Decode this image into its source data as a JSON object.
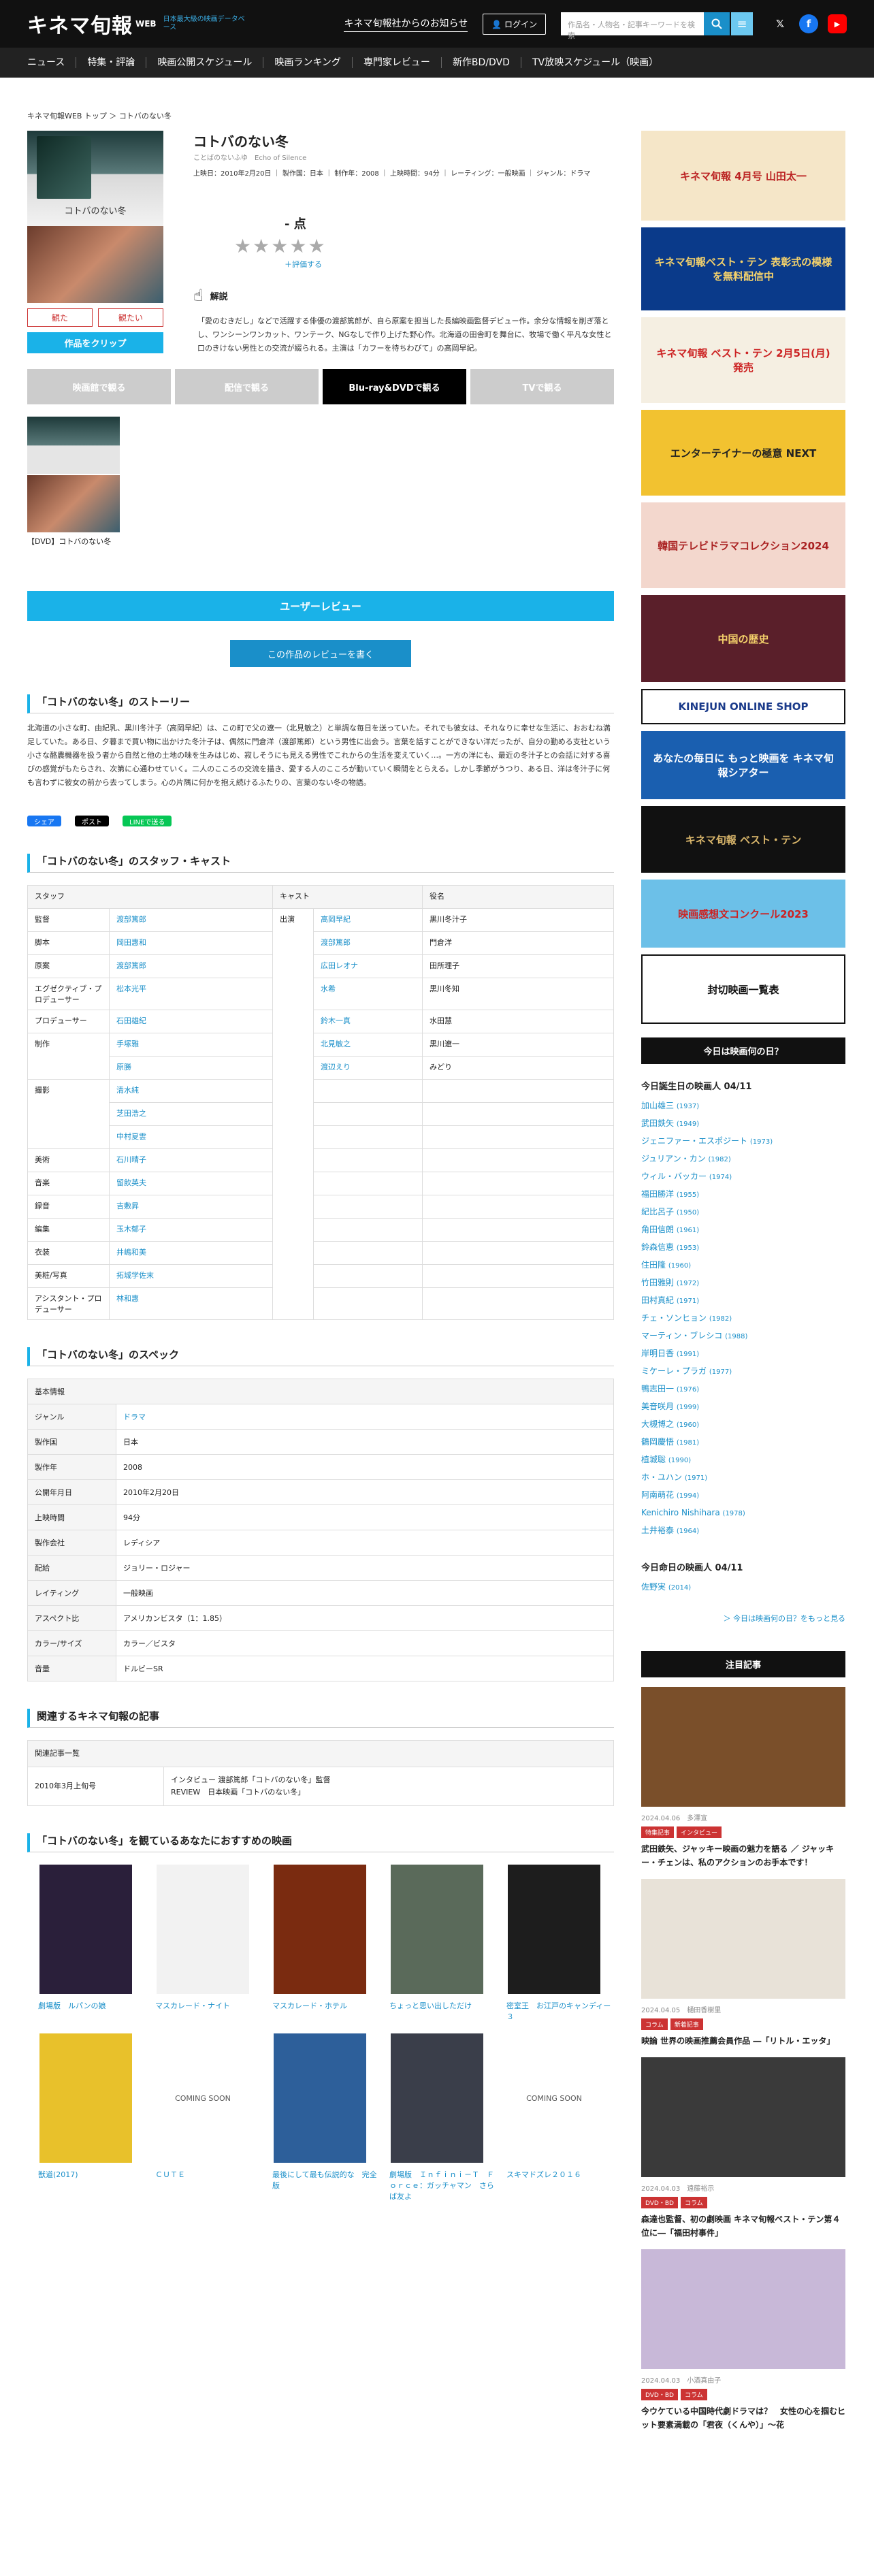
{
  "header": {
    "logo": "キネマ旬報",
    "logo_web": "WEB",
    "logo_sub": "日本最大級の映画データベース",
    "news_link": "キネマ旬報社からのお知らせ",
    "login": "ログイン",
    "search_placeholder": "作品名・人物名・記事キーワードを検索"
  },
  "nav": [
    "ニュース",
    "特集・評論",
    "映画公開スケジュール",
    "映画ランキング",
    "専門家レビュー",
    "新作BD/DVD",
    "TV放映スケジュール（映画）"
  ],
  "breadcrumb": "キネマ旬報WEB トップ ＞ コトバのない冬",
  "film": {
    "poster_text": "コトバのない冬",
    "title": "コトバのない冬",
    "kana": "ことばのないふゆ　Echo of Silence",
    "meta": "上映日：2010年2月20日 ｜ 製作国：日本 ｜ 制作年：2008 ｜ 上映時間：94分 ｜ レーティング：一般映画 ｜ ジャンル：ドラマ",
    "score": "- 点",
    "rate_link": "＋評価する",
    "seen": "観た",
    "want": "観たい",
    "clip": "作品をクリップ",
    "kaisetsu_label": "解説",
    "kaisetsu": "「愛のむきだし」などで活躍する俳優の渡部篤郎が、自ら原案を担当した長編映画監督デビュー作。余分な情報を削ぎ落とし、ワンシーンワンカット、ワンテーク、NGなしで作り上げた野心作。北海道の田舎町を舞台に、牧場で働く平凡な女性と口のきけない男性との交流が綴られる。主演は「カフーを待ちわびて」の高岡早紀。"
  },
  "tabs": [
    "映画館で観る",
    "配信で観る",
    "Blu-ray&DVDで観る",
    "TVで観る"
  ],
  "dvd_label": "【DVD】コトバのない冬",
  "user_review": "ユーザーレビュー",
  "write_review": "この作品のレビューを書く",
  "story_title": "「コトバのない冬」のストーリー",
  "story": "北海道の小さな町、由紀乳、黒川冬汁子（高岡早紀）は、この町で父の遼一（北見敏之）と単調な毎日を送っていた。それでも彼女は、それなりに幸せな生活に、おおむね満足していた。ある日、夕暮まで買い物に出かけた冬汁子は、偶然に門倉洋（渡部篤郎）という男性に出会う。言葉を話すことができない洋だったが、自分の勤める支社という小さな酪農機器を扱う者から自然と他の土地の味を生みはじめ、寂しそうにも見える男性でこれからの生活を変えていく…。一方の洋にも、最近の冬汁子との会話に対する喜びの感覚がもたらされ、次第に心通わせていく。二人のこころの交流を描き、愛する人のこころが動いていく瞬間をとらえる。しかし季節がうつり、ある日、洋は冬汁子に何も言わずに彼女の前から去ってしまう。心の片隅に何かを抱え続けるふたりの、言葉のない冬の物語。",
  "share": {
    "fb": "シェア",
    "x": "ポスト",
    "line": "LINEで送る"
  },
  "staff_title": "「コトバのない冬」のスタッフ・キャスト",
  "staff_head": {
    "staff": "スタッフ",
    "cast": "キャスト",
    "role": "役名"
  },
  "staff": [
    {
      "role": "監督",
      "names": [
        "渡部篤郎"
      ]
    },
    {
      "role": "脚本",
      "names": [
        "岡田惠和"
      ]
    },
    {
      "role": "原案",
      "names": [
        "渡部篤郎"
      ]
    },
    {
      "role": "エグゼクティブ・プロデューサー",
      "names": [
        "松本光平"
      ]
    },
    {
      "role": "プロデューサー",
      "names": [
        "石田雄紀"
      ]
    },
    {
      "role": "制作",
      "names": [
        "手塚雅",
        "原勝"
      ]
    },
    {
      "role": "撮影",
      "names": [
        "清水純",
        "芝田浩之",
        "中村夏雲"
      ]
    },
    {
      "role": "美術",
      "names": [
        "石川晴子"
      ]
    },
    {
      "role": "音楽",
      "names": [
        "留飲英夫"
      ]
    },
    {
      "role": "録音",
      "names": [
        "吉敷昇"
      ]
    },
    {
      "role": "編集",
      "names": [
        "玉木郁子"
      ]
    },
    {
      "role": "衣装",
      "names": [
        "井嶋和美"
      ]
    },
    {
      "role": "美粧/写真",
      "names": [
        "拓城学佐末"
      ]
    },
    {
      "role": "アシスタント・プロデューサー",
      "names": [
        "林和惠"
      ]
    }
  ],
  "cast_label": "出演",
  "cast": [
    {
      "name": "高岡早紀",
      "role": "黒川冬汁子"
    },
    {
      "name": "渡部篤郎",
      "role": "門倉洋"
    },
    {
      "name": "広田レオナ",
      "role": "田所理子"
    },
    {
      "name": "水希",
      "role": "黒川冬知"
    },
    {
      "name": "鈴木一真",
      "role": "水田慧"
    },
    {
      "name": "北見敏之",
      "role": "黒川遼一"
    },
    {
      "name": "渡辺えり",
      "role": "みどり"
    }
  ],
  "spec_title": "「コトバのない冬」のスペック",
  "spec_head": "基本情報",
  "spec": [
    {
      "k": "ジャンル",
      "v": "ドラマ",
      "link": true
    },
    {
      "k": "製作国",
      "v": "日本"
    },
    {
      "k": "製作年",
      "v": "2008"
    },
    {
      "k": "公開年月日",
      "v": "2010年2月20日"
    },
    {
      "k": "上映時間",
      "v": "94分"
    },
    {
      "k": "製作会社",
      "v": "レディシア"
    },
    {
      "k": "配給",
      "v": "ジョリー・ロジャー"
    },
    {
      "k": "レイティング",
      "v": "一般映画"
    },
    {
      "k": "アスペクト比",
      "v": "アメリカンビスタ（1：1.85）"
    },
    {
      "k": "カラー/サイズ",
      "v": "カラー／ビスタ"
    },
    {
      "k": "音量",
      "v": "ドルビーSR"
    }
  ],
  "articles_title": "関連するキネマ旬報の記事",
  "articles_head": "関連記事一覧",
  "article": {
    "date": "2010年3月上旬号",
    "line1": "インタビュー 渡部篤郎「コトバのない冬」監督",
    "line2": "REVIEW　日本映画「コトバのない冬」"
  },
  "recs_title": "「コトバのない冬」を観ているあなたにおすすめの映画",
  "recs": [
    {
      "name": "劇場版　ルパンの娘",
      "color": "#2a1f3a"
    },
    {
      "name": "マスカレード・ナイト",
      "color": "#f2f2f2"
    },
    {
      "name": "マスカレード・ホテル",
      "color": "#7a2b10"
    },
    {
      "name": "ちょっと思い出しただけ",
      "color": "#5a6a5a"
    },
    {
      "name": "密室王　お江戸のキャンディー３",
      "color": "#1d1d1d"
    },
    {
      "name": "獣道(2017)",
      "color": "#e8c12b"
    },
    {
      "name": "ＣＵＴＥ",
      "soon": "COMING SOON"
    },
    {
      "name": "最後にして最も伝説的な　完全版",
      "color": "#2d5f9a"
    },
    {
      "name": "劇場版　Ｉｎｆｉｎｉ－Ｔ　Ｆｏｒｃｅ：ガッチャマン　さらば友よ",
      "color": "#3a3e4a"
    },
    {
      "name": "スキマドズレ２０１６",
      "soon": "COMING SOON"
    }
  ],
  "side": {
    "ads": [
      {
        "text": "キネマ旬報 4月号 山田太一",
        "bg": "#f5e6c8",
        "fg": "#b22",
        "h": 132
      },
      {
        "text": "キネマ旬報ベスト・テン 表彰式の模様を無料配信中",
        "bg": "#0a3a8a",
        "fg": "#f5d26b",
        "h": 122
      },
      {
        "text": "キネマ旬報 ベスト・テン 2月5日(月)発売",
        "bg": "#f5efe2",
        "fg": "#c22",
        "h": 126
      },
      {
        "text": "エンターテイナーの極意 NEXT",
        "bg": "#f2c230",
        "fg": "#222",
        "h": 126
      },
      {
        "text": "韓国テレビドラマコレクション2024",
        "bg": "#f3d7cd",
        "fg": "#a22",
        "h": 126
      },
      {
        "text": "中国の歴史",
        "bg": "#5a1f2a",
        "fg": "#f5d26b",
        "h": 128
      },
      {
        "text": "KINEJUN ONLINE SHOP",
        "bg": "#fff",
        "fg": "#1a3a8a",
        "h": 52,
        "border": true
      },
      {
        "text": "あなたの毎日に もっと映画を キネマ旬報シアター",
        "bg": "#1a5fb0",
        "fg": "#fff",
        "h": 100
      },
      {
        "text": "キネマ旬報 ベスト・テン",
        "bg": "#111",
        "fg": "#d9b66b",
        "h": 98
      },
      {
        "text": "映画感想文コンクール2023",
        "bg": "#6cc0e8",
        "fg": "#c22",
        "h": 100
      },
      {
        "text": "封切映画一覧表",
        "bg": "#fff",
        "fg": "#111",
        "h": 102,
        "border": true
      }
    ],
    "bday_head": "今日は映画何の日？",
    "bday_title": "今日誕生日の映画人 04/11",
    "bday": [
      {
        "n": "加山雄三",
        "y": "(1937)"
      },
      {
        "n": "武田鉄矢",
        "y": "(1949)"
      },
      {
        "n": "ジェニファー・エスポジート",
        "y": "(1973)"
      },
      {
        "n": "ジュリアン・カン",
        "y": "(1982)"
      },
      {
        "n": "ウィル・バッカー",
        "y": "(1974)"
      },
      {
        "n": "福田勝洋",
        "y": "(1955)"
      },
      {
        "n": "紀比呂子",
        "y": "(1950)"
      },
      {
        "n": "角田信朗",
        "y": "(1961)"
      },
      {
        "n": "鈴森信恵",
        "y": "(1953)"
      },
      {
        "n": "住田隆",
        "y": "(1960)"
      },
      {
        "n": "竹田雅則",
        "y": "(1972)"
      },
      {
        "n": "田村真紀",
        "y": "(1971)"
      },
      {
        "n": "チェ・ソンヒョン",
        "y": "(1982)"
      },
      {
        "n": "マーティン・ブレシコ",
        "y": "(1988)"
      },
      {
        "n": "岸明日香",
        "y": "(1991)"
      },
      {
        "n": "ミケーレ・プラガ",
        "y": "(1977)"
      },
      {
        "n": "鴨志田一",
        "y": "(1976)"
      },
      {
        "n": "美音咲月",
        "y": "(1999)"
      },
      {
        "n": "大槻博之",
        "y": "(1960)"
      },
      {
        "n": "鶴岡慶悟",
        "y": "(1981)"
      },
      {
        "n": "植城聡",
        "y": "(1990)"
      },
      {
        "n": "ホ・ユハン",
        "y": "(1971)"
      },
      {
        "n": "阿南萌花",
        "y": "(1994)"
      },
      {
        "n": "Kenichiro Nishihara",
        "y": "(1978)"
      },
      {
        "n": "土井裕泰",
        "y": "(1964)"
      }
    ],
    "death_title": "今日命日の映画人 04/11",
    "death": [
      {
        "n": "佐野実",
        "y": "(2014)"
      }
    ],
    "more": "＞ 今日は映画何の日？をもっと見る",
    "news_head": "注目記事",
    "news": [
      {
        "date": "2024.04.06　多澤宣",
        "tags": [
          "特集記事",
          "インタビュー"
        ],
        "title": "武田鉄矢、ジャッキー映画の魅力を語る ／ ジャッキー・チェンは、私のアクションのお手本です！",
        "bg": "#7a4f2a"
      },
      {
        "date": "2024.04.05　樋田香樹里",
        "tags": [
          "コラム",
          "新着記事"
        ],
        "title": "映論 世界の映画推薦会員作品 ―「リトル・エッタ」",
        "bg": "#e8e2d8"
      },
      {
        "date": "2024.04.03　遠藤裕示",
        "tags": [
          "DVD・BD",
          "コラム"
        ],
        "title": "森達也監督、初の劇映画 キネマ旬報ベスト・テン第４位に―「福田村事件」",
        "bg": "#3a3a3a"
      },
      {
        "date": "2024.04.03　小酒真由子",
        "tags": [
          "DVD・BD",
          "コラム"
        ],
        "title": "今ウケている中国時代劇ドラマは？　女性の心を掴むヒット要素満載の「君夜（くんや）」～花",
        "bg": "#c8b8d8"
      }
    ]
  }
}
